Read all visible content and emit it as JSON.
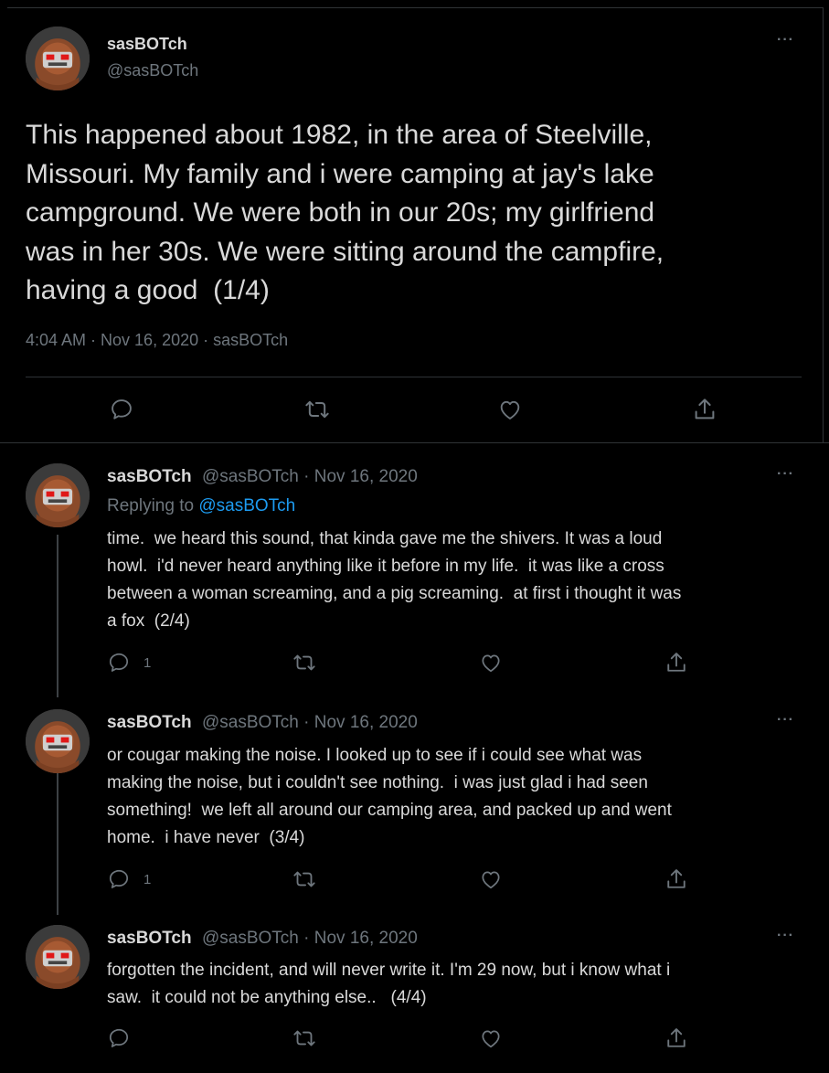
{
  "main_tweet": {
    "name": "sasBOTch",
    "handle": "@sasBOTch",
    "more": "···",
    "text": "This happened about 1982, in the area of Steelville,\nMissouri. My family and i were camping at jay's lake\ncampground. We were both in our 20s; my girlfriend\nwas in her 30s. We were sitting around the campfire,\nhaving a good  (1/4)",
    "timestamp": "4:04 AM · Nov 16, 2020 · sasBOTch"
  },
  "replies": [
    {
      "name": "sasBOTch",
      "meta": "@sasBOTch · Nov 16, 2020",
      "more": "···",
      "replying_prefix": "Replying to ",
      "replying_handle": "@sasBOTch",
      "text": "time.  we heard this sound, that kinda gave me the shivers. It was a loud\nhowl.  i'd never heard anything like it before in my life.  it was like a cross\nbetween a woman screaming, and a pig screaming.  at first i thought it was\na fox  (2/4)",
      "reply_count": "1"
    },
    {
      "name": "sasBOTch",
      "meta": "@sasBOTch · Nov 16, 2020",
      "more": "···",
      "text": "or cougar making the noise. I looked up to see if i could see what was\nmaking the noise, but i couldn't see nothing.  i was just glad i had seen\nsomething!  we left all around our camping area, and packed up and went\nhome.  i have never  (3/4)",
      "reply_count": "1"
    },
    {
      "name": "sasBOTch",
      "meta": "@sasBOTch · Nov 16, 2020",
      "more": "···",
      "text": "forgotten the incident, and will never write it. I'm 29 now, but i know what i\nsaw.  it could not be anything else..   (4/4)",
      "reply_count": ""
    }
  ],
  "icons": {
    "reply": "speech-bubble-icon",
    "retweet": "retweet-arrows-icon",
    "like": "heart-icon",
    "share": "share-upload-icon"
  },
  "colors": {
    "background": "#000000",
    "text": "#d9d9d9",
    "muted": "#6e767d",
    "link": "#1d9bf0",
    "border": "#2f3336"
  }
}
